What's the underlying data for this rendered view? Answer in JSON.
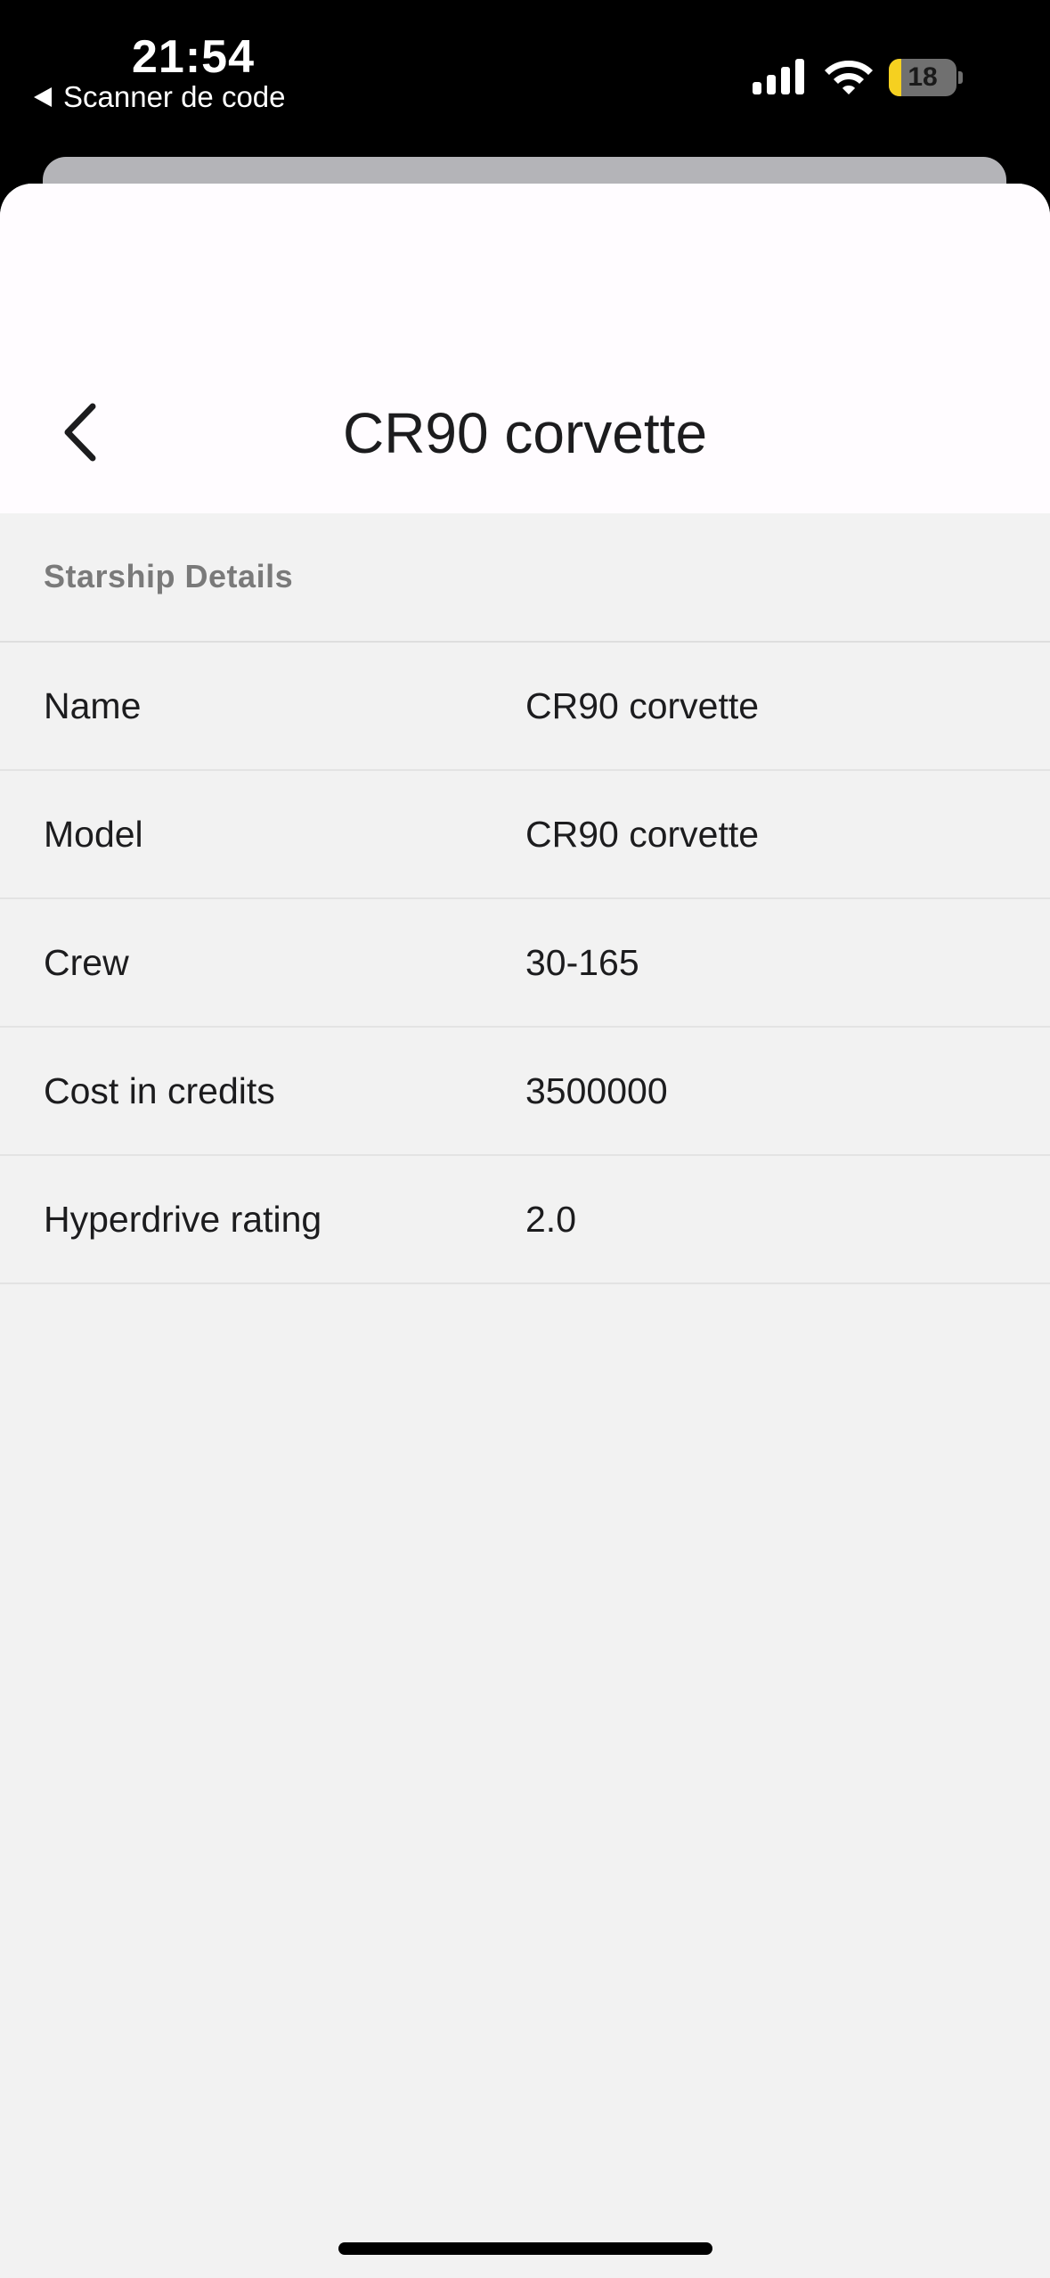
{
  "status_bar": {
    "time": "21:54",
    "back_app_label": "Scanner de code",
    "battery_level": "18",
    "battery_fraction": 0.18,
    "battery_color": "#f5d020"
  },
  "header": {
    "back_icon": "chevron-left-icon",
    "title": "CR90 corvette"
  },
  "section": {
    "title": "Starship Details"
  },
  "details": [
    {
      "label": "Name",
      "value": "CR90 corvette"
    },
    {
      "label": "Model",
      "value": "CR90 corvette"
    },
    {
      "label": "Crew",
      "value": "30-165"
    },
    {
      "label": "Cost in credits",
      "value": "3500000"
    },
    {
      "label": "Hyperdrive rating",
      "value": "2.0"
    }
  ]
}
